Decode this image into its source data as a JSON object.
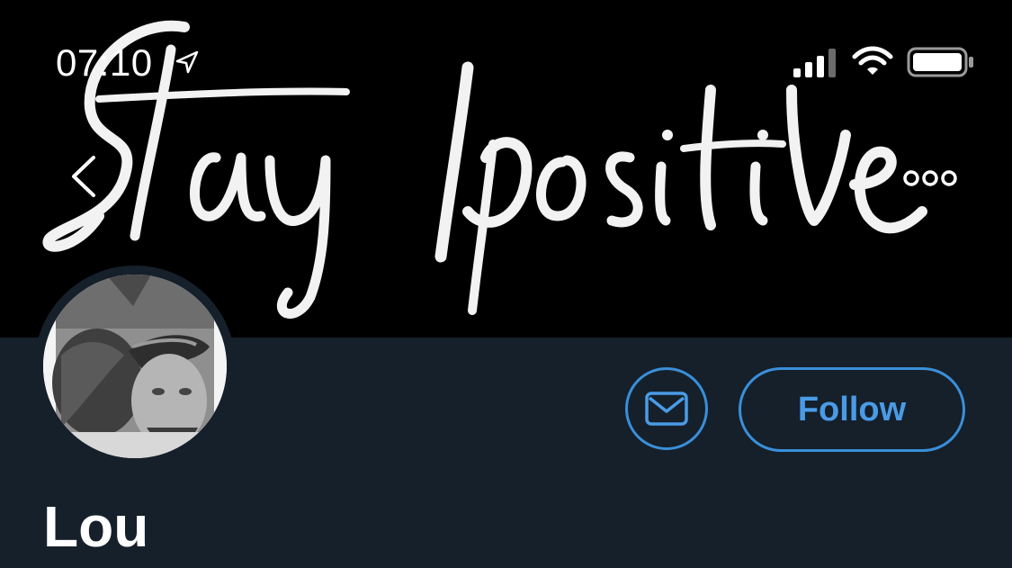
{
  "status_bar": {
    "time": "07:10",
    "location_icon": "location-arrow-icon",
    "signal_icon": "cellular-signal-icon",
    "wifi_icon": "wifi-icon",
    "battery_icon": "battery-icon"
  },
  "banner": {
    "image": "banner-image",
    "logo_text": "Stay positive",
    "background_color": "#000000"
  },
  "nav": {
    "back_icon": "chevron-left-icon",
    "more_icon": "more-horizontal-icon"
  },
  "profile": {
    "display_name": "Lou",
    "avatar": "profile-avatar"
  },
  "actions": {
    "message_icon": "envelope-icon",
    "follow_label": "Follow"
  },
  "colors": {
    "page_background": "#15202b",
    "accent": "#3a8fd9",
    "text_primary": "#ffffff"
  }
}
